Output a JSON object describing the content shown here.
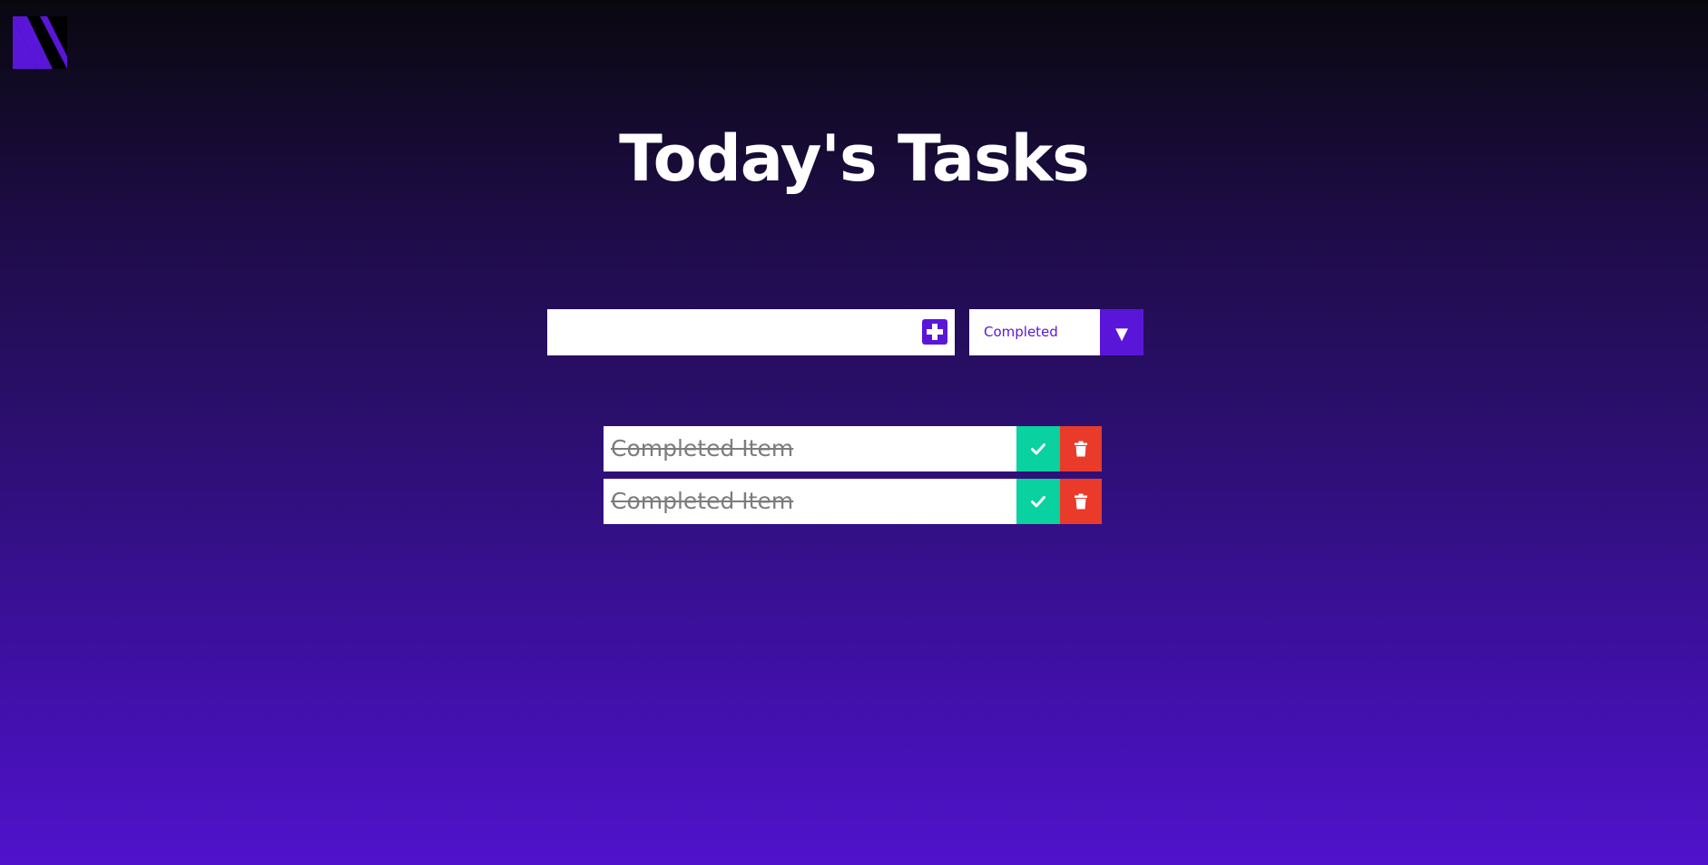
{
  "page": {
    "title": "Today's Tasks"
  },
  "logo": {
    "icon": "n-stripe-logo-icon",
    "colors": {
      "primary": "#5a16d8",
      "secondary": "#000000"
    }
  },
  "form": {
    "input_value": "",
    "add_icon": "plus-square-icon",
    "filter": {
      "selected": "Completed",
      "arrow": "▼"
    }
  },
  "todos": [
    {
      "text": "Completed Item",
      "completed": true,
      "check_icon": "check-icon",
      "delete_icon": "trash-icon"
    },
    {
      "text": "Completed Item",
      "completed": true,
      "check_icon": "check-icon",
      "delete_icon": "trash-icon"
    }
  ],
  "colors": {
    "accent": "#5a16d8",
    "complete": "#0ad1a0",
    "delete": "#e93a2a",
    "background_top": "#09080f",
    "background_bottom": "#5012cc"
  }
}
